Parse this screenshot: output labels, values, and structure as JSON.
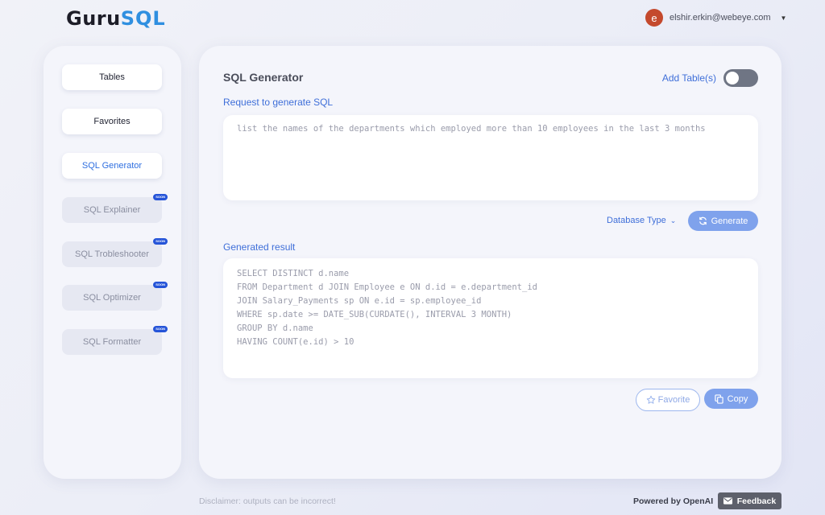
{
  "header": {
    "logo_left": "Guru",
    "logo_right": "SQL",
    "user_initial": "e",
    "user_email": "elshir.erkin@webeye.com"
  },
  "sidebar": {
    "items": [
      {
        "label": "Tables",
        "state": "active"
      },
      {
        "label": "Favorites",
        "state": "active"
      },
      {
        "label": "SQL Generator",
        "state": "current"
      },
      {
        "label": "SQL Explainer",
        "state": "disabled",
        "badge": "SOON"
      },
      {
        "label": "SQL Trobleshooter",
        "state": "disabled",
        "badge": "SOON"
      },
      {
        "label": "SQL Optimizer",
        "state": "disabled",
        "badge": "SOON"
      },
      {
        "label": "SQL Formatter",
        "state": "disabled",
        "badge": "SOON"
      }
    ]
  },
  "main": {
    "title": "SQL Generator",
    "add_table_label": "Add Table(s)",
    "request_label": "Request to generate SQL",
    "request_text": "list the names of the departments which employed more than 10 employees in the last 3 months",
    "database_type_label": "Database Type",
    "generate_label": "Generate",
    "result_label": "Generated result",
    "result_lines": [
      "SELECT DISTINCT d.name",
      "FROM Department d JOIN Employee e ON d.id = e.department_id",
      "JOIN Salary_Payments sp ON e.id = sp.employee_id",
      "WHERE sp.date >= DATE_SUB(CURDATE(), INTERVAL 3 MONTH)",
      "GROUP BY d.name",
      "HAVING COUNT(e.id) > 10"
    ],
    "favorite_label": "Favorite",
    "copy_label": "Copy"
  },
  "footer": {
    "disclaimer": "Disclaimer: outputs can be incorrect!",
    "powered_by": "Powered by OpenAI",
    "feedback_label": "Feedback"
  },
  "colors": {
    "accent": "#3f6fd9",
    "button_blue": "#7fa2ec",
    "avatar": "#c4492d",
    "badge": "#2554d8"
  }
}
